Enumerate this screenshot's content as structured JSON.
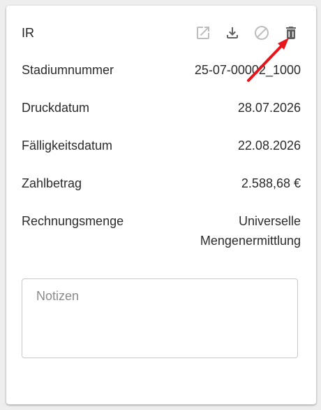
{
  "card": {
    "title": "IR",
    "actions": [
      {
        "icon": "open-external-icon",
        "enabled": false
      },
      {
        "icon": "download-icon",
        "enabled": true
      },
      {
        "icon": "block-icon",
        "enabled": false
      },
      {
        "icon": "delete-icon",
        "enabled": true
      }
    ],
    "rows": [
      {
        "label": "Stadiumnummer",
        "value": "25-07-00002_1000"
      },
      {
        "label": "Druckdatum",
        "value": "28.07.2026"
      },
      {
        "label": "Fälligkeitsdatum",
        "value": "22.08.2026"
      },
      {
        "label": "Zahlbetrag",
        "value": "2.588,68 €"
      },
      {
        "label": "Rechnungsmenge",
        "value": "Universelle Mengenermittlung"
      }
    ],
    "notes": {
      "placeholder": "Notizen",
      "value": ""
    }
  },
  "colors": {
    "icon_disabled": "#bdbdbd",
    "icon_enabled": "#616161",
    "annotation_arrow": "#e8141b"
  }
}
